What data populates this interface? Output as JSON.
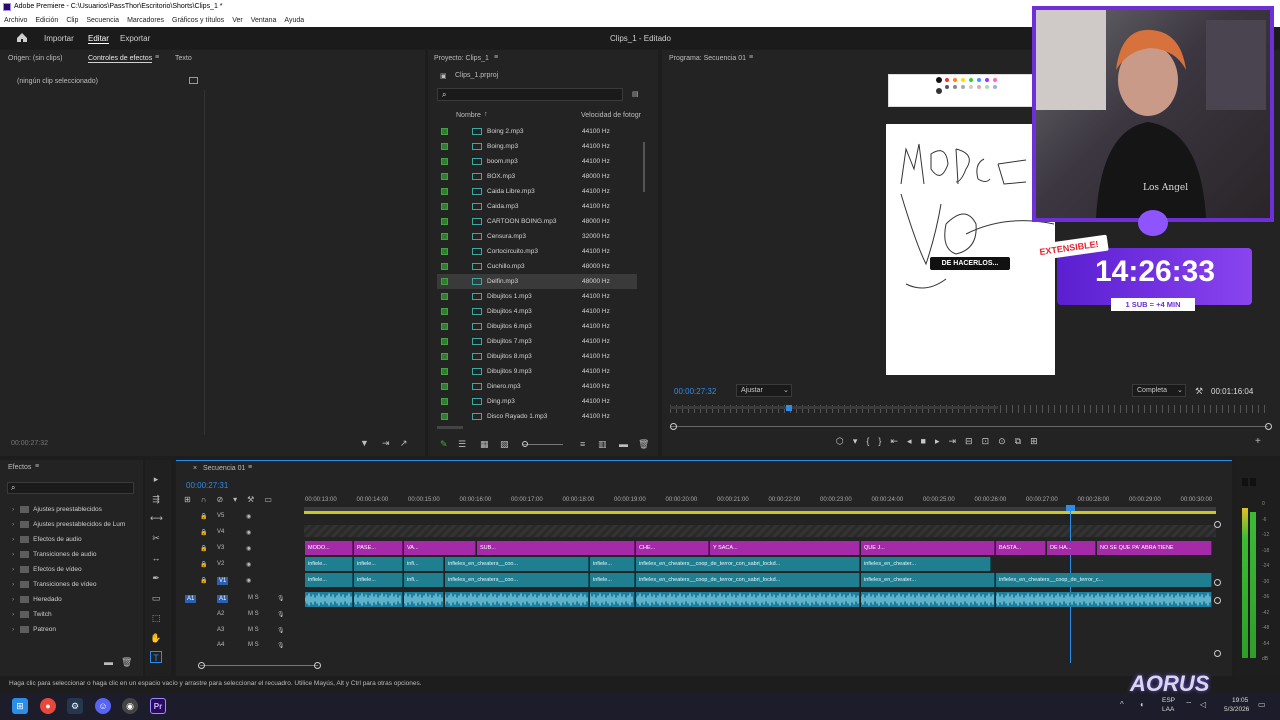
{
  "window": {
    "title": "Adobe Premiere - C:\\Usuarios\\PassThor\\Escritorio\\Shorts\\Clips_1 *"
  },
  "menu": [
    "Archivo",
    "Edición",
    "Clip",
    "Secuencia",
    "Marcadores",
    "Gráficos y títulos",
    "Ver",
    "Ventana",
    "Ayuda"
  ],
  "header": {
    "tabs": [
      "Importar",
      "Editar",
      "Exportar"
    ],
    "active_tab": "Editar",
    "doc_title": "Clips_1 - Editado"
  },
  "source_panel": {
    "origin_label": "Origen: (sin clips)",
    "effects_controls_tab": "Controles de efectos",
    "text_tab": "Texto",
    "no_clip": "(ningún clip seleccionado)",
    "timecode": "00:00:27:32"
  },
  "project_panel": {
    "title": "Proyecto: Clips_1",
    "file": "Clips_1.prproj",
    "col_name": "Nombre",
    "col_rate": "Velocidad de fotogr",
    "files": [
      {
        "name": "Boing 2.mp3",
        "rate": "44100 Hz"
      },
      {
        "name": "Boing.mp3",
        "rate": "44100 Hz"
      },
      {
        "name": "boom.mp3",
        "rate": "44100 Hz"
      },
      {
        "name": "BOX.mp3",
        "rate": "48000 Hz"
      },
      {
        "name": "Caida Libre.mp3",
        "rate": "44100 Hz"
      },
      {
        "name": "Caida.mp3",
        "rate": "44100 Hz"
      },
      {
        "name": "CARTOON BOING.mp3",
        "rate": "48000 Hz"
      },
      {
        "name": "Censura.mp3",
        "rate": "32000 Hz"
      },
      {
        "name": "Cortocircuito.mp3",
        "rate": "44100 Hz"
      },
      {
        "name": "Cuchillo.mp3",
        "rate": "48000 Hz"
      },
      {
        "name": "Delfin.mp3",
        "rate": "48000 Hz"
      },
      {
        "name": "Dibujitos 1.mp3",
        "rate": "44100 Hz"
      },
      {
        "name": "Dibujitos 4.mp3",
        "rate": "44100 Hz"
      },
      {
        "name": "Dibujitos 6.mp3",
        "rate": "44100 Hz"
      },
      {
        "name": "Dibujitos 7.mp3",
        "rate": "44100 Hz"
      },
      {
        "name": "Dibujitos 8.mp3",
        "rate": "44100 Hz"
      },
      {
        "name": "Dibujitos 9.mp3",
        "rate": "44100 Hz"
      },
      {
        "name": "Dinero.mp3",
        "rate": "44100 Hz"
      },
      {
        "name": "Ding.mp3",
        "rate": "44100 Hz"
      },
      {
        "name": "Disco Rayado 1.mp3",
        "rate": "44100 Hz"
      }
    ]
  },
  "program_panel": {
    "title": "Programa: Secuencia 01",
    "timecode": "00:00:27:32",
    "fit": "Ajustar",
    "quality": "Completa",
    "duration": "00:01:16:04",
    "caption": "DE HACERLOS..."
  },
  "overlay": {
    "badge": "EXTENSIBLE!",
    "timer": "14:26:33",
    "rule": "1 SUB = +4 MIN",
    "shirt_text": "Los Angel"
  },
  "effects_panel": {
    "title": "Efectos",
    "items": [
      "Ajustes preestablecidos",
      "Ajustes preestablecidos de Lum",
      "Efectos de audio",
      "Transiciones de audio",
      "Efectos de vídeo",
      "Transiciones de vídeo",
      "Heredado",
      "Twitch",
      "Patreon"
    ]
  },
  "timeline": {
    "title": "Secuencia 01",
    "timecode": "00:00:27:31",
    "ruler": [
      "00:00:13:00",
      "00:00:14:00",
      "00:00:15:00",
      "00:00:16:00",
      "00:00:17:00",
      "00:00:18:00",
      "00:00:19:00",
      "00:00:20:00",
      "00:00:21:00",
      "00:00:22:00",
      "00:00:23:00",
      "00:00:24:00",
      "00:00:25:00",
      "00:00:26:00",
      "00:00:27:00",
      "00:00:28:00",
      "00:00:29:00",
      "00:00:30:00"
    ],
    "video_tracks": [
      "V5",
      "V4",
      "V3",
      "V2",
      "V1"
    ],
    "audio_tracks": [
      "A1",
      "A2",
      "A3",
      "A4"
    ],
    "v3_clips": [
      "MODO...",
      "PASE...",
      "VA...",
      "SUB...",
      "CHE...",
      "Y SACA...",
      "QUE J...",
      "BASTA...",
      "DE HA...",
      "NO SE QUE PA' ABRA TIENE"
    ],
    "v2_clips": [
      "infiele...",
      "infiele...",
      "infi...",
      "infieles_en_cheaters__coo...",
      "infiele...",
      "infieles_en_cheaters__coop_de_terror_con_sabri_lockd...",
      "infieles_en_cheater..."
    ],
    "v1_clips": [
      "infiele...",
      "infiele...",
      "infi...",
      "infieles_en_cheaters__coo...",
      "infiele...",
      "infieles_en_cheaters__coop_de_terror_con_sabri_lockd...",
      "infieles_en_cheater...",
      "infieles_en_cheaters__coop_de_terror_c..."
    ]
  },
  "meter_labels": [
    "0",
    "-6",
    "-12",
    "-18",
    "-24",
    "-30",
    "-36",
    "-42",
    "-48",
    "-54",
    "dB"
  ],
  "status": "Haga clic para seleccionar o haga clic en un espacio vacío y arrastre para seleccionar el recuadro. Utilice Mayús, Alt y Ctrl para otras opciones.",
  "taskbar": {
    "lang": "ESP",
    "region": "LAA",
    "time": "19:05",
    "date": "5/3/2026",
    "brand": "AORUS"
  },
  "colors": {
    "accent": "#2d8ceb",
    "pink_clip": "#a42aa8",
    "teal_clip": "#1f7f91",
    "timer_bg": "#7b3ae0"
  }
}
